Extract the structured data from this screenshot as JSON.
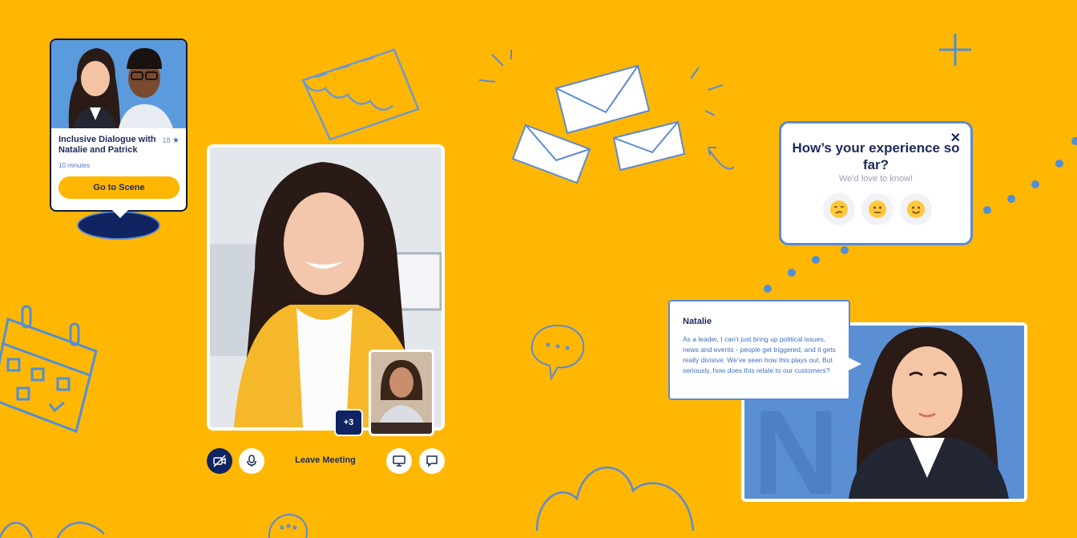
{
  "scene_card": {
    "title": "Inclusive Dialogue with Natalie and Patrick",
    "rating": "18",
    "duration": "10 minutes",
    "button_label": "Go to Scene"
  },
  "video_call": {
    "participants_overflow": "+3",
    "leave_label": "Leave Meeting",
    "controls": [
      "camera-off-icon",
      "microphone-icon",
      "screen-share-icon",
      "chat-icon"
    ]
  },
  "feedback": {
    "title": "How’s your experience so far?",
    "subtitle": "We’d love to know!",
    "options": [
      "😒",
      "😐",
      "🙂"
    ]
  },
  "chat": {
    "speaker": "Natalie",
    "message": "As a leader, I can’t just bring up political issues, news and events - people get triggered, and it gets really divisive. We’ve seen how this plays out. But seriously, how does this relate to our customers?"
  },
  "colors": {
    "background": "#FFB703",
    "navy": "#0f2460",
    "accent_blue": "#5b8ad6"
  }
}
